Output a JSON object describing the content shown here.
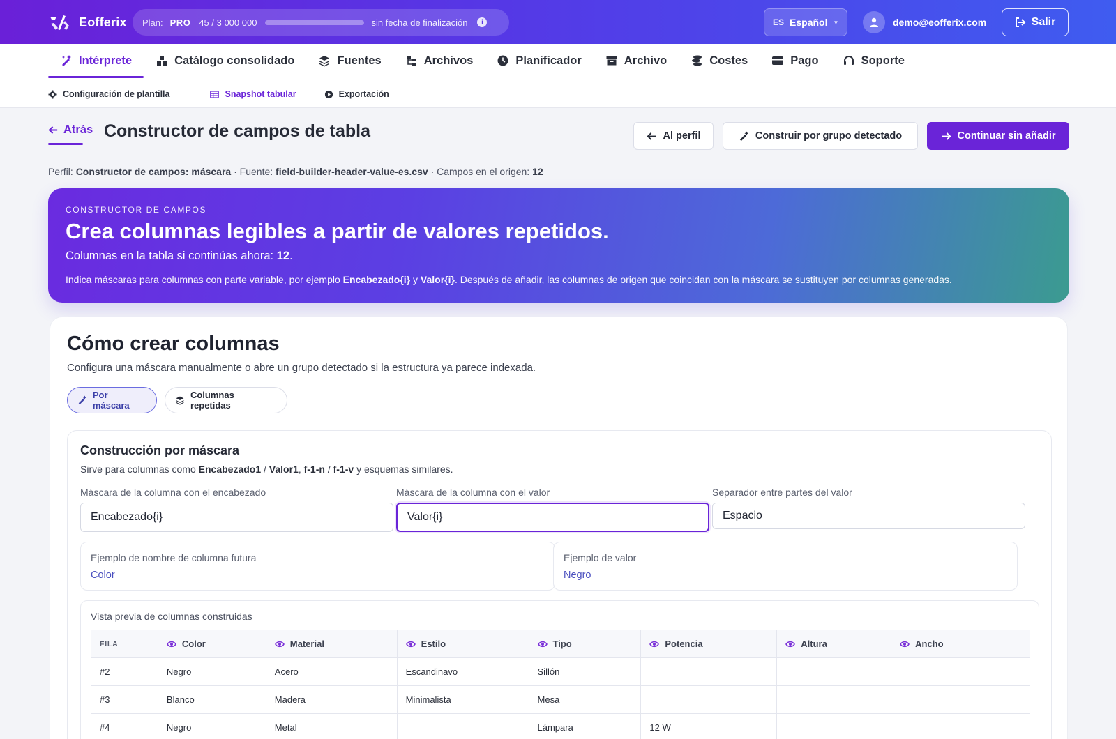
{
  "brand": {
    "name": "Eofferix"
  },
  "plan": {
    "label": "Plan:",
    "tier": "PRO",
    "usage": "45  /  3 000 000",
    "progress_fraction": 1.5e-05,
    "no_end": "sin fecha de finalización"
  },
  "lang": {
    "code": "ES",
    "label": "Español"
  },
  "user": {
    "email": "demo@eofferix.com"
  },
  "logout": {
    "label": "Salir"
  },
  "nav": {
    "tabs": [
      {
        "label": "Intérprete",
        "icon": "wand-icon",
        "active": true
      },
      {
        "label": "Catálogo consolidado",
        "icon": "boxes-icon"
      },
      {
        "label": "Fuentes",
        "icon": "layers-icon"
      },
      {
        "label": "Archivos",
        "icon": "folder-tree-icon"
      },
      {
        "label": "Planificador",
        "icon": "clock-icon"
      },
      {
        "label": "Archivo",
        "icon": "archive-icon"
      },
      {
        "label": "Costes",
        "icon": "coins-icon"
      },
      {
        "label": "Pago",
        "icon": "card-icon"
      },
      {
        "label": "Soporte",
        "icon": "headset-icon"
      }
    ],
    "subtabs": [
      {
        "label": "Configuración de plantilla",
        "icon": "gear-icon"
      },
      {
        "label": "Snapshot tabular",
        "icon": "table-icon",
        "active": true
      },
      {
        "label": "Exportación",
        "icon": "play-circle-icon"
      }
    ]
  },
  "header": {
    "back_label": "Atrás",
    "title": "Constructor de campos de tabla",
    "btn_profile": "Al perfil",
    "btn_group": "Construir por grupo detectado",
    "btn_continue": "Continuar sin añadir"
  },
  "meta": {
    "profile_label": "Perfil:",
    "profile_value": "Constructor de campos: máscara",
    "source_label": "· Fuente:",
    "source_value": "field-builder-header-value-es.csv",
    "fields_label": "· Campos en el origen:",
    "fields_value": "12"
  },
  "hero": {
    "eyebrow": "CONSTRUCTOR DE CAMPOS",
    "headline": "Crea columnas legibles a partir de valores repetidos.",
    "count_prefix": "Columnas en la tabla si continúas ahora:",
    "count_value": "12",
    "count_suffix": ".",
    "desc_a": "Indica máscaras para columnas con parte variable, por ejemplo",
    "desc_b": "Encabezado{i}",
    "desc_c": "y",
    "desc_d": "Valor{i}",
    "desc_e": ". Después de añadir, las columnas de origen que coincidan con la máscara se sustituyen por columnas generadas."
  },
  "card": {
    "title": "Cómo crear columnas",
    "subtitle": "Configura una máscara manualmente o abre un grupo detectado si la estructura ya parece indexada.",
    "mode_mask": "Por máscara",
    "mode_repeat": "Columnas repetidas"
  },
  "mask": {
    "title": "Construcción por máscara",
    "hint_a": "Sirve para columnas como",
    "hint_b": "Encabezado1",
    "hint_c": "/",
    "hint_d": "Valor1",
    "hint_e": ",",
    "hint_f": "f-1-n",
    "hint_g": "/",
    "hint_h": "f-1-v",
    "hint_i": "y esquemas similares.",
    "header_label": "Máscara de la columna con el encabezado",
    "header_value": "Encabezado{i}",
    "value_label": "Máscara de la columna con el valor",
    "value_value": "Valor{i}",
    "sep_label": "Separador entre partes del valor",
    "sep_value": "Espacio",
    "ex_name_label": "Ejemplo de nombre de columna futura",
    "ex_name_value": "Color",
    "ex_value_label": "Ejemplo de valor",
    "ex_value_value": "Negro"
  },
  "preview": {
    "label": "Vista previa de columnas construidas",
    "row_header": "FILA",
    "columns": [
      "Color",
      "Material",
      "Estilo",
      "Tipo",
      "Potencia",
      "Altura",
      "Ancho"
    ],
    "rows": [
      [
        "#2",
        "Negro",
        "Acero",
        "Escandinavo",
        "Sillón",
        "",
        "",
        ""
      ],
      [
        "#3",
        "Blanco",
        "Madera",
        "Minimalista",
        "Mesa",
        "",
        "",
        ""
      ],
      [
        "#4",
        "Negro",
        "Metal",
        "",
        "Lámpara",
        "12 W",
        "",
        ""
      ]
    ]
  },
  "colors": {
    "accent": "#6a24d8",
    "hero_start": "#6a2be0",
    "hero_end": "#3b9b90"
  }
}
